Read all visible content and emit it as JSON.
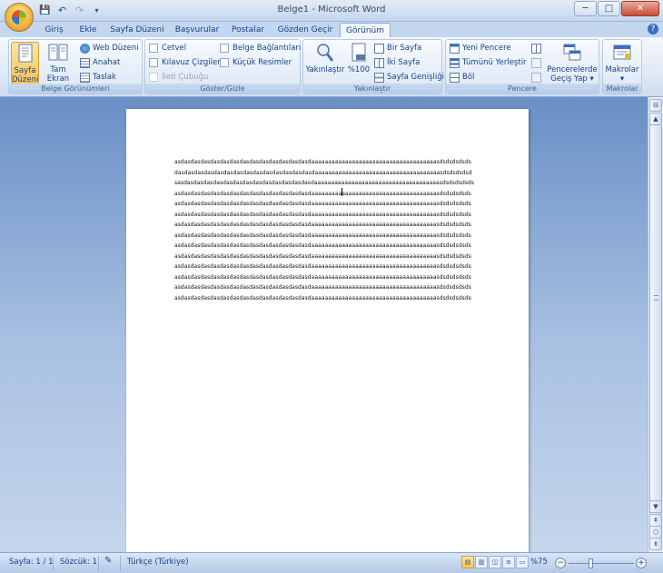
{
  "window": {
    "title": "Belge1 - Microsoft Word",
    "controls": [
      "─",
      "□",
      "✕"
    ]
  },
  "qat": {
    "save": "💾",
    "undo": "↶",
    "redo": "↷",
    "customize": "▾"
  },
  "tabs": [
    {
      "label": "Giriş",
      "active": false
    },
    {
      "label": "Ekle",
      "active": false
    },
    {
      "label": "Sayfa Düzeni",
      "active": false
    },
    {
      "label": "Başvurular",
      "active": false
    },
    {
      "label": "Postalar",
      "active": false
    },
    {
      "label": "Gözden Geçir",
      "active": false
    },
    {
      "label": "Görünüm",
      "active": true
    }
  ],
  "ribbon": {
    "belge_gorunumleri": {
      "label": "Belge Görünümleri",
      "sayfa_duzeni": "Sayfa Düzeni",
      "tam_ekran": "Tam Ekran Okuma",
      "web_duzeni": "Web Düzeni",
      "anahat": "Anahat",
      "taslak": "Taslak"
    },
    "goster_gizle": {
      "label": "Göster/Gizle",
      "cetvel": "Cetvel",
      "kilavuz": "Kılavuz Çizgileri",
      "ileti": "İleti Çubuğu",
      "belge_baglantilari": "Belge Bağlantıları",
      "kucuk_resimler": "Küçük Resimler"
    },
    "yakinlastir": {
      "label": "Yakınlaştır",
      "yakinlastir_btn": "Yakınlaştır",
      "yuzde100": "%100",
      "bir_sayfa": "Bir Sayfa",
      "iki_sayfa": "İki Sayfa",
      "sayfa_genisligi": "Sayfa Genişliği"
    },
    "pencere": {
      "label": "Pencere",
      "yeni_pencere": "Yeni Pencere",
      "tumunu_yerlestir": "Tümünü Yerleştir",
      "bol": "Böl",
      "gecis": "Pencerelerde Geçiş Yap"
    },
    "makrolar": {
      "label": "Makrolar",
      "makrolar_btn": "Makrolar"
    }
  },
  "document": {
    "lines": [
      "asdasdasdasdasdasdasdasdasdasdasdasdasdasdaaaaaaaaaaaaaaaaaaaaaaaaaaaaaaaaaaaaasdsdsdsdsds",
      "dasdasdasdasdasdasdasdasdasdasdasdasdasdasdaaaaaaaaaaaaaaaaaaaaaaaaaaaaaaaaaaaaasdsdsdsdsd",
      "sasdasdasdasdasdasdasdasdasdasdasdasdasdasdaaaaaaaaaaaaaaaaaaaaaaaaaaaaaaaaaaaaasdsdsdsdsds",
      "asdasdasdasdasdasdasdasdasdasdasdasdasdasdaaaaaaaaaaaaaaaaaaaaaaaaaaaaaaaaaaaaasdsdsdsdsds",
      "asdasdasdasdasdasdasdasdasdasdasdasdasdasdaaaaaaaaaaaaaaaaaaaaaaaaaaaaaaaaaaaaasdsdsdsdsds",
      "asdasdasdasdasdasdasdasdasdasdasdasdasdasdaaaaaaaaaaaaaaaaaaaaaaaaaaaaaaaaaaaaasdsdsdsdsds",
      "asdasdasdasdasdasdasdasdasdasdasdasdasdasdaaaaaaaaaaaaaaaaaaaaaaaaaaaaaaaaaaaaasdsdsdsdsds",
      "asdasdasdasdasdasdasdasdasdasdasdasdasdasdaaaaaaaaaaaaaaaaaaaaaaaaaaaaaaaaaaaaasdsdsdsdsds",
      "asdasdasdasdasdasdasdasdasdasdasdasdasdasdaaaaaaaaaaaaaaaaaaaaaaaaaaaaaaaaaaaaasdsdsdsdsds",
      "asdasdasdasdasdasdasdasdasdasdasdasdasdasdaaaaaaaaaaaaaaaaaaaaaaaaaaaaaaaaaaaaasdsdsdsdsds",
      "asdasdasdasdasdasdasdasdasdasdasdasdasdasdaaaaaaaaaaaaaaaaaaaaaaaaaaaaaaaaaaaaasdsdsdsdsds",
      "asdasdasdasdasdasdasdasdasdasdasdasdasdasdaaaaaaaaaaaaaaaaaaaaaaaaaaaaaaaaaaaaasdsdsdsdsds",
      "asdasdasdasdasdasdasdasdasdasdasdasdasdasdaaaaaaaaaaaaaaaaaaaaaaaaaaaaaaaaaaaaasdsdsdsdsds",
      "asdasdasdasdasdasdasdasdasdasdasdasdasdasdaaaaaaaaaaaaaaaaaaaaaaaaaaaaaaaaaaaaasdsdsdsdsds"
    ]
  },
  "status": {
    "page": "Sayfa: 1 / 1",
    "words": "Sözcük: 1",
    "language": "Türkçe (Türkiye)",
    "zoom": "%75",
    "zoom_minus": "−",
    "zoom_plus": "+"
  },
  "colors": {
    "accent": "#15428b",
    "active_btn": "#f9c453",
    "ribbon_bg": "#dfe9f5"
  }
}
